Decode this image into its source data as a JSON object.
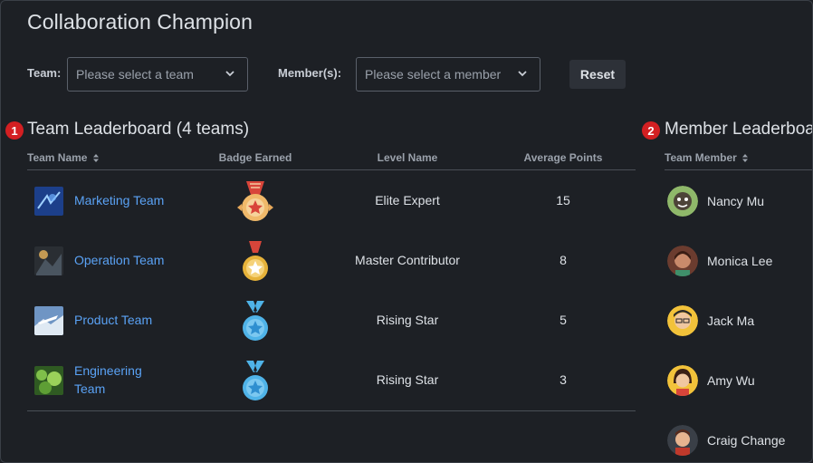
{
  "page": {
    "title": "Collaboration Champion"
  },
  "filters": {
    "team_label": "Team:",
    "team_placeholder": "Please select a team",
    "member_label": "Member(s):",
    "member_placeholder": "Please select a member",
    "reset_label": "Reset"
  },
  "team_board": {
    "marker": "1",
    "title": "Team Leaderboard (4 teams)",
    "columns": {
      "name": "Team Name",
      "badge": "Badge Earned",
      "level": "Level Name",
      "points": "Average Points"
    },
    "rows": [
      {
        "name": "Marketing Team",
        "level": "Elite Expert",
        "points": "15",
        "badge_icon": "elite-expert-medal-icon"
      },
      {
        "name": "Operation Team",
        "level": "Master Contributor",
        "points": "8",
        "badge_icon": "master-contributor-medal-icon"
      },
      {
        "name": "Product Team",
        "level": "Rising Star",
        "points": "5",
        "badge_icon": "rising-star-medal-icon"
      },
      {
        "name": "Engineering Team",
        "name_line1": "Engineering",
        "name_line2": "Team",
        "level": "Rising Star",
        "points": "3",
        "badge_icon": "rising-star-medal-icon"
      }
    ]
  },
  "member_board": {
    "marker": "2",
    "title": "Member Leaderboard",
    "columns": {
      "member": "Team Member"
    },
    "members": [
      {
        "name": "Nancy Mu"
      },
      {
        "name": "Monica Lee"
      },
      {
        "name": "Jack Ma"
      },
      {
        "name": "Amy Wu"
      },
      {
        "name": "Craig Change"
      }
    ]
  },
  "colors": {
    "background": "#1d2025",
    "link": "#5aa2f5",
    "marker": "#d31f22",
    "gold": "#e6b23a",
    "blue_medal": "#4fb3e8"
  }
}
